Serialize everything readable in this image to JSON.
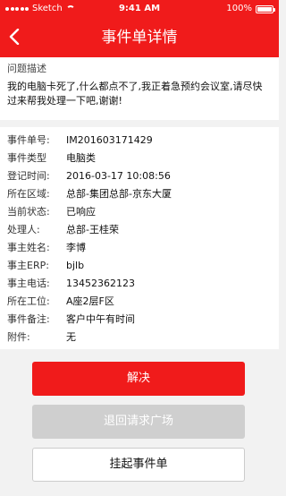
{
  "statusbar": {
    "carrier": "Sketch",
    "time": "9:41 AM",
    "battery": "100%"
  },
  "nav": {
    "title": "事件单详情",
    "back_icon": "chevron-left-icon"
  },
  "description": {
    "label": "问题描述",
    "text": "我的电脑卡死了,什么都点不了,我正着急预约会议室,请尽快过来帮我处理一下吧,谢谢!"
  },
  "details": [
    {
      "label": "事件单号:",
      "value": "IM201603171429"
    },
    {
      "label": "事件类型",
      "value": "电脑类"
    },
    {
      "label": "登记时间:",
      "value": "2016-03-17 10:08:56"
    },
    {
      "label": "所在区域:",
      "value": "总部-集团总部-京东大厦"
    },
    {
      "label": "当前状态:",
      "value": "已响应"
    },
    {
      "label": "处理人:",
      "value": "总部-王桂荣"
    },
    {
      "label": "事主姓名:",
      "value": "李博"
    },
    {
      "label": "事主ERP:",
      "value": "bjlb"
    },
    {
      "label": "事主电话:",
      "value": "13452362123"
    },
    {
      "label": "所在工位:",
      "value": "A座2层F区"
    },
    {
      "label": "事件备注:",
      "value": "客户中午有时间"
    },
    {
      "label": "附件:",
      "value": "无"
    }
  ],
  "actions": {
    "resolve": "解决",
    "return_to_plaza": "退回请求广场",
    "suspend": "挂起事件单"
  },
  "colors": {
    "brand": "#f01b1b",
    "disabled": "#cfcfcf"
  }
}
